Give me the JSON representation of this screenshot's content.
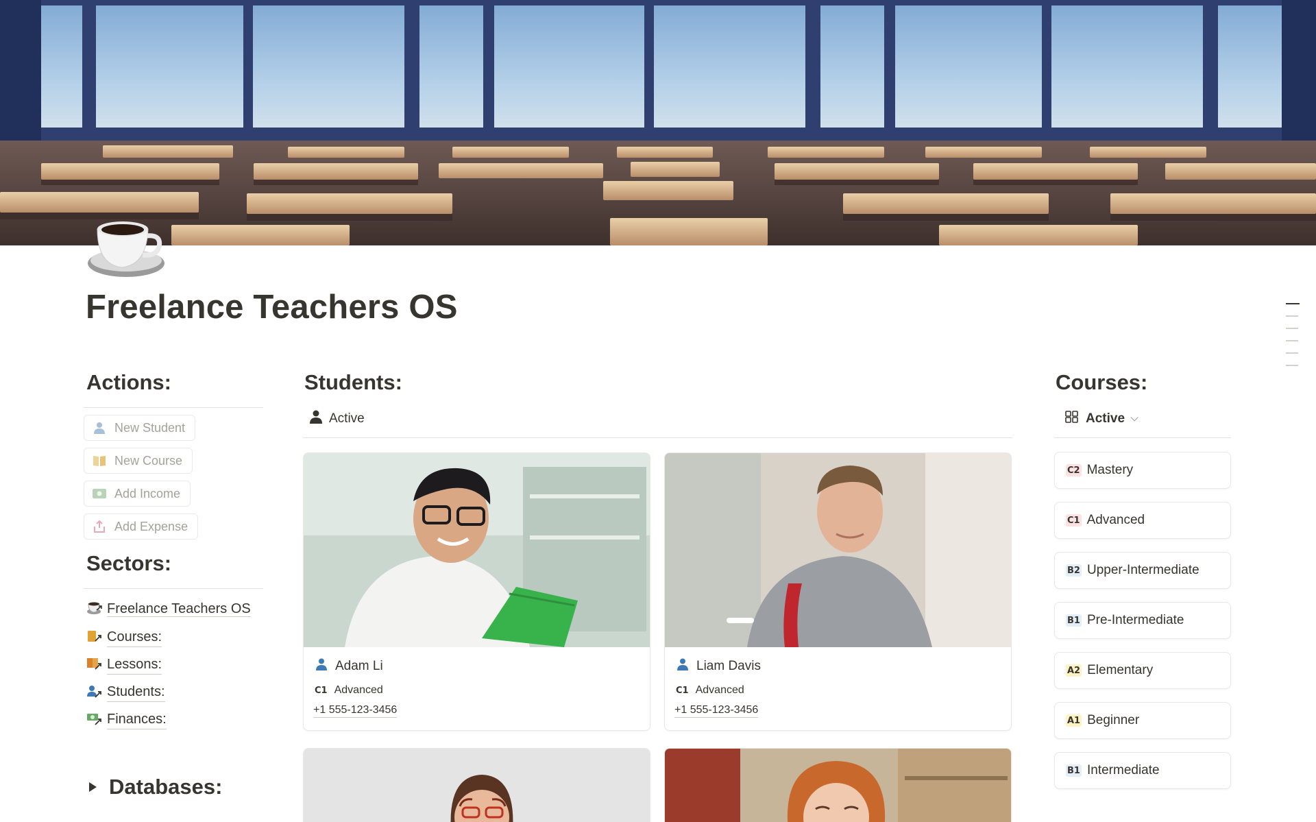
{
  "page": {
    "title": "Freelance Teachers OS",
    "icon": "coffee-cup-icon"
  },
  "actions": {
    "heading": "Actions:",
    "buttons": [
      {
        "label": "New Student",
        "icon": "person-icon"
      },
      {
        "label": "New Course",
        "icon": "book-icon"
      },
      {
        "label": "Add Income",
        "icon": "cash-icon"
      },
      {
        "label": "Add Expense",
        "icon": "export-icon"
      }
    ]
  },
  "sectors": {
    "heading": "Sectors:",
    "links": [
      {
        "label": "Freelance Teachers OS",
        "icon": "coffee-link-icon"
      },
      {
        "label": "Courses:",
        "icon": "courses-link-icon"
      },
      {
        "label": "Lessons:",
        "icon": "lessons-link-icon"
      },
      {
        "label": "Students:",
        "icon": "students-link-icon"
      },
      {
        "label": "Finances:",
        "icon": "finances-link-icon"
      }
    ]
  },
  "databases": {
    "heading": "Databases:"
  },
  "students": {
    "heading": "Students:",
    "view": "Active",
    "cards": [
      {
        "name": "Adam Li",
        "level_tag": "C1",
        "level": "Advanced",
        "phone": "+1 555-123-3456"
      },
      {
        "name": "Liam Davis",
        "level_tag": "C1",
        "level": "Advanced",
        "phone": "+1 555-123-3456"
      }
    ]
  },
  "courses": {
    "heading": "Courses:",
    "view": "Active",
    "items": [
      {
        "tag": "C2",
        "label": "Mastery"
      },
      {
        "tag": "C1",
        "label": "Advanced"
      },
      {
        "tag": "B2",
        "label": "Upper-Intermediate"
      },
      {
        "tag": "B1",
        "label": "Pre-Intermediate"
      },
      {
        "tag": "A2",
        "label": "Elementary"
      },
      {
        "tag": "A1",
        "label": "Beginner"
      },
      {
        "tag": "B1",
        "label": "Intermediate"
      }
    ]
  }
}
